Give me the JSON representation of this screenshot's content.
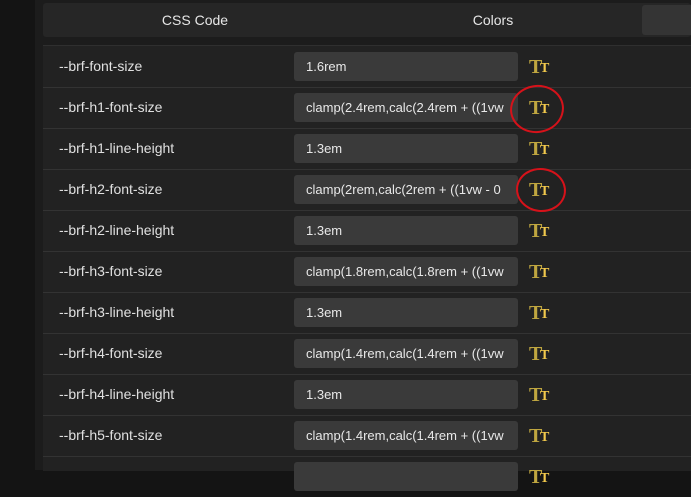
{
  "tabs": {
    "css_code": "CSS Code",
    "colors": "Colors"
  },
  "rows": [
    {
      "name": "--brf-font-size",
      "value": "1.6rem"
    },
    {
      "name": "--brf-h1-font-size",
      "value": "clamp(2.4rem,calc(2.4rem + ((1vw"
    },
    {
      "name": "--brf-h1-line-height",
      "value": "1.3em"
    },
    {
      "name": "--brf-h2-font-size",
      "value": "clamp(2rem,calc(2rem + ((1vw - 0"
    },
    {
      "name": "--brf-h2-line-height",
      "value": "1.3em"
    },
    {
      "name": "--brf-h3-font-size",
      "value": "clamp(1.8rem,calc(1.8rem + ((1vw"
    },
    {
      "name": "--brf-h3-line-height",
      "value": "1.3em"
    },
    {
      "name": "--brf-h4-font-size",
      "value": "clamp(1.4rem,calc(1.4rem + ((1vw"
    },
    {
      "name": "--brf-h4-line-height",
      "value": "1.3em"
    },
    {
      "name": "--brf-h5-font-size",
      "value": "clamp(1.4rem,calc(1.4rem + ((1vw"
    },
    {
      "name": "",
      "value": ""
    }
  ],
  "icon_glyph": "T",
  "colors": {
    "icon_gold": "#bfa640",
    "annotation_red": "#d6121a"
  }
}
